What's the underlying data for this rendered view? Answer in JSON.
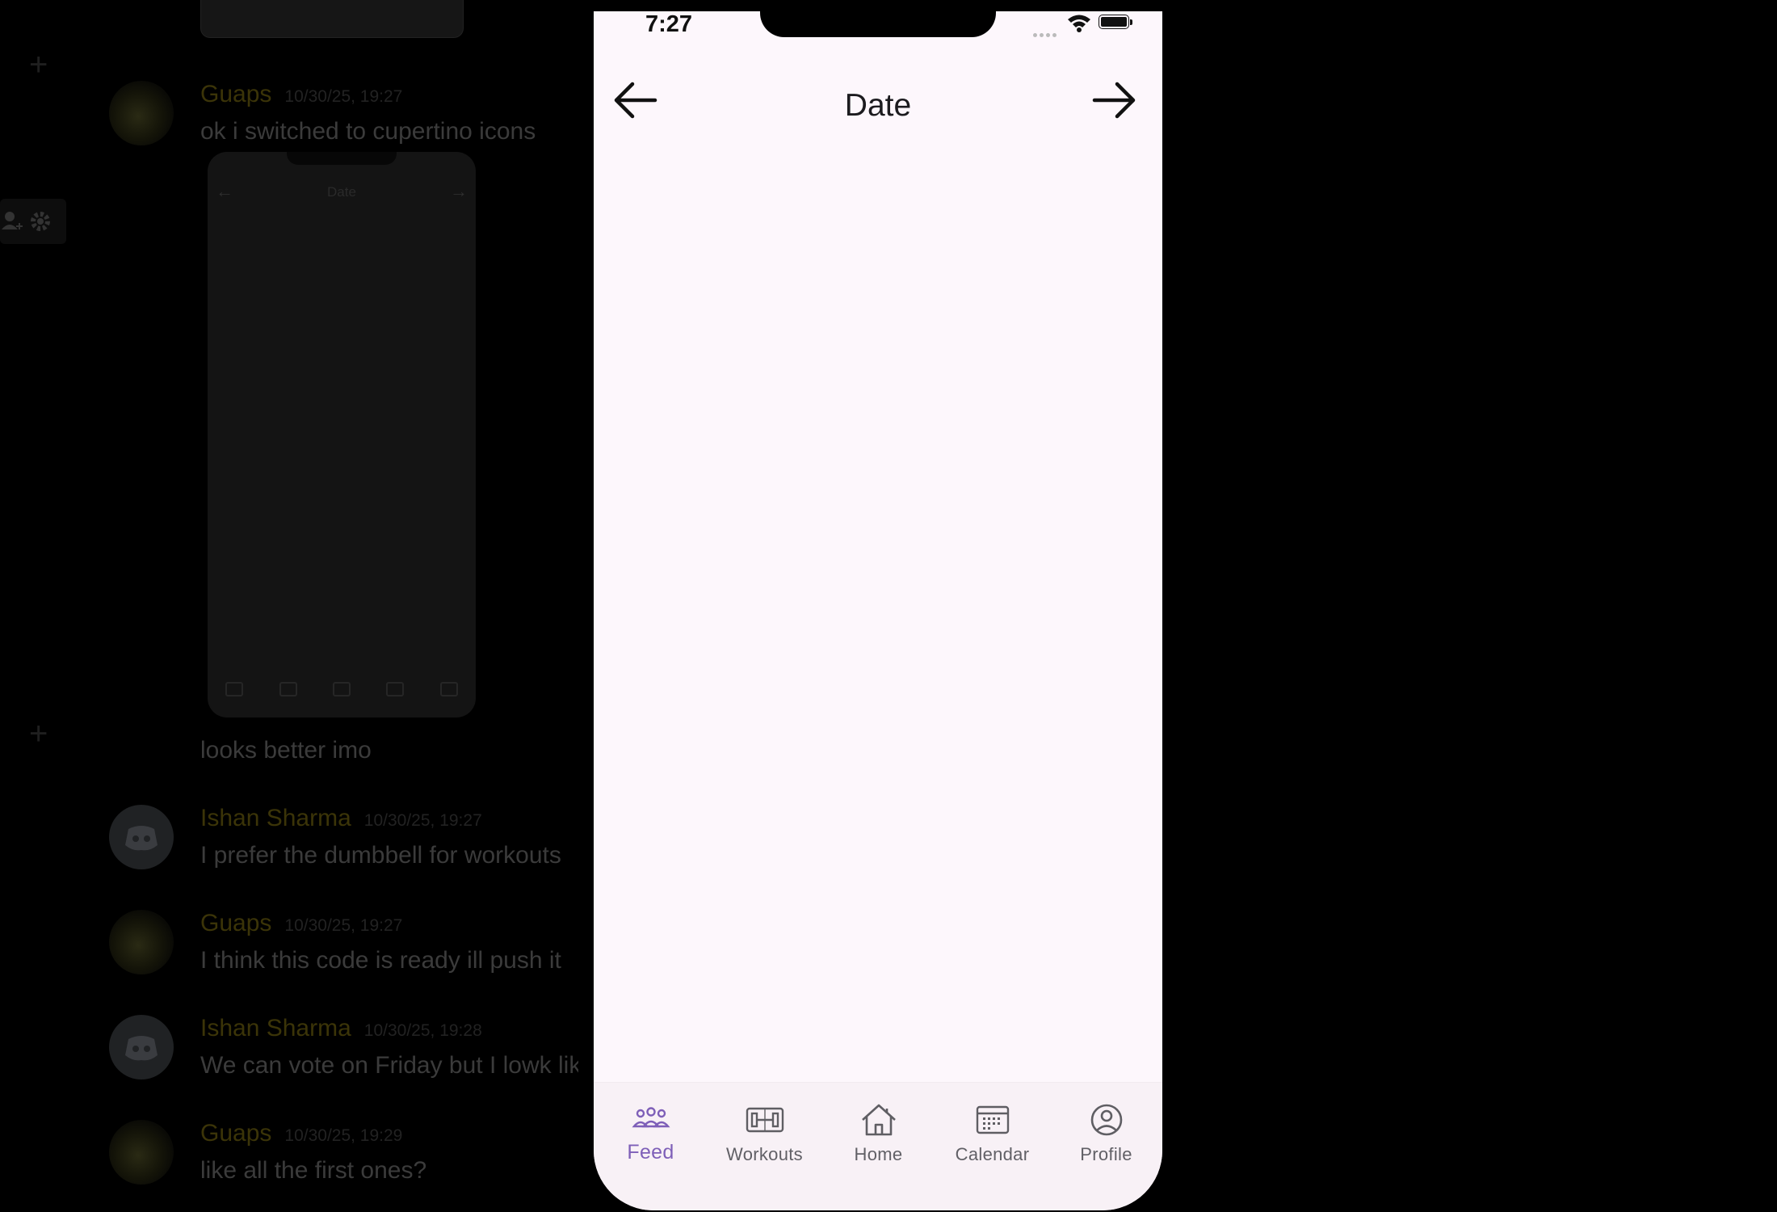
{
  "chat": {
    "messages": [
      {
        "author": "Guaps",
        "timestamp": "10/30/25, 19:27",
        "text": "ok i switched to cupertino icons",
        "avatar": "guaps"
      },
      {
        "author": "",
        "timestamp": "",
        "text": "looks better imo",
        "avatar": ""
      },
      {
        "author": "Ishan Sharma",
        "timestamp": "10/30/25, 19:27",
        "text": "I prefer the dumbbell for workouts",
        "avatar": "discord"
      },
      {
        "author": "Guaps",
        "timestamp": "10/30/25, 19:27",
        "text": "I think this code is ready ill push it",
        "avatar": "guaps"
      },
      {
        "author": "Ishan Sharma",
        "timestamp": "10/30/25, 19:28",
        "text": "We can vote on Friday but I lowk lik",
        "avatar": "discord"
      },
      {
        "author": "Guaps",
        "timestamp": "10/30/25, 19:29",
        "text": "like all the first ones?",
        "avatar": "guaps"
      }
    ],
    "attachment_preview": {
      "title": "Date"
    }
  },
  "phone": {
    "status_bar": {
      "time": "7:27"
    },
    "header": {
      "title": "Date",
      "back_icon": "arrow-left-icon",
      "forward_icon": "arrow-right-icon"
    },
    "tabs": [
      {
        "label": "Feed",
        "icon": "people-icon",
        "active": true
      },
      {
        "label": "Workouts",
        "icon": "dumbbell-icon",
        "active": false
      },
      {
        "label": "Home",
        "icon": "house-icon",
        "active": false
      },
      {
        "label": "Calendar",
        "icon": "calendar-icon",
        "active": false
      },
      {
        "label": "Profile",
        "icon": "profile-icon",
        "active": false
      }
    ],
    "colors": {
      "screen_bg": "#fdf7fc",
      "accent": "#7e5fb8",
      "tab_label": "#616066"
    }
  }
}
